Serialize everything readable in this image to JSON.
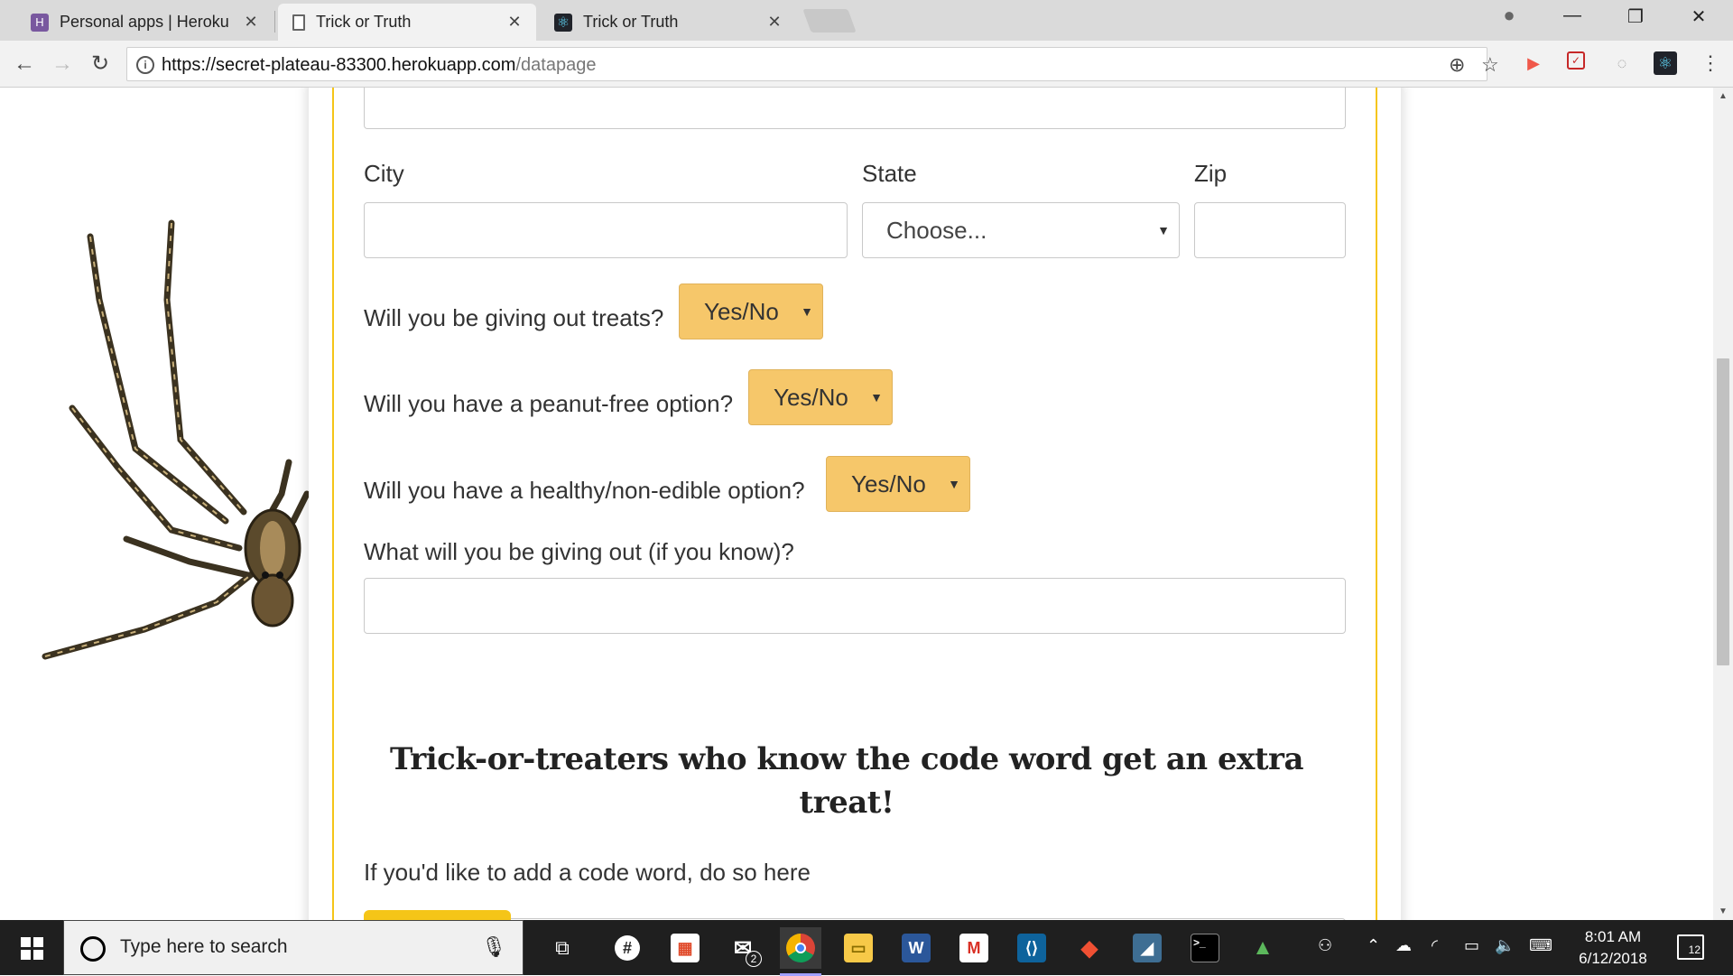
{
  "browser": {
    "tabs": [
      {
        "title": "Personal apps | Heroku",
        "favicon": "heroku-icon",
        "active": false
      },
      {
        "title": "Trick or Truth",
        "favicon": "document-icon",
        "active": true
      },
      {
        "title": "Trick or Truth",
        "favicon": "react-icon",
        "active": false
      }
    ],
    "url_host": "https://secret-plateau-83300.herokuapp.com",
    "url_path": "/datapage",
    "close_glyph": "✕"
  },
  "form": {
    "city_label": "City",
    "state_label": "State",
    "zip_label": "Zip",
    "state_select_value": "Choose...",
    "treats_question": "Will you be giving out treats?",
    "peanut_question": "Will you have a peanut-free option?",
    "healthy_question": "Will you have a healthy/non-edible option?",
    "yes_no": "Yes/No",
    "giving_out_label": "What will you be giving out (if you know)?",
    "headline": "Trick-or-treaters who know the code word get an extra treat!",
    "code_word_label": "If you'd like to add a code word, do so here"
  },
  "taskbar": {
    "search_placeholder": "Type here to search",
    "mail_badge": "2",
    "time": "8:01 AM",
    "date": "6/12/2018",
    "notification_count": "12"
  },
  "colors": {
    "accent_yellow": "#f5c518",
    "yes_no_fill": "#f6c76a",
    "taskbar": "#1f1f1f"
  }
}
